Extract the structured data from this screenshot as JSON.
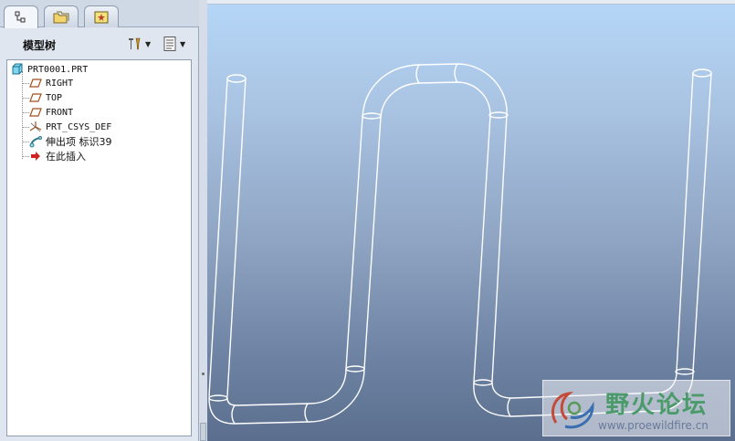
{
  "left_panel": {
    "title": "模型树",
    "tabs": [
      "model-tree",
      "folder-browser",
      "favorites"
    ]
  },
  "tree": {
    "root": "PRT0001.PRT",
    "items": [
      {
        "label": "RIGHT",
        "icon": "datum-plane-icon"
      },
      {
        "label": "TOP",
        "icon": "datum-plane-icon"
      },
      {
        "label": "FRONT",
        "icon": "datum-plane-icon"
      },
      {
        "label": "PRT_CSYS_DEF",
        "icon": "csys-icon"
      },
      {
        "label": "伸出项 标识39",
        "icon": "sweep-protrusion-icon"
      },
      {
        "label": "在此插入",
        "icon": "insert-here-arrow-icon"
      }
    ]
  },
  "watermark": {
    "title": "野火论坛",
    "url": "www.proewildfire.cn"
  },
  "colors": {
    "panel_bg": "#dfe6f0",
    "viewport_top": "#b6d7f8",
    "viewport_bottom": "#5b6e8e",
    "insert_arrow": "#d22020",
    "plane_icon": "#a0521e"
  }
}
